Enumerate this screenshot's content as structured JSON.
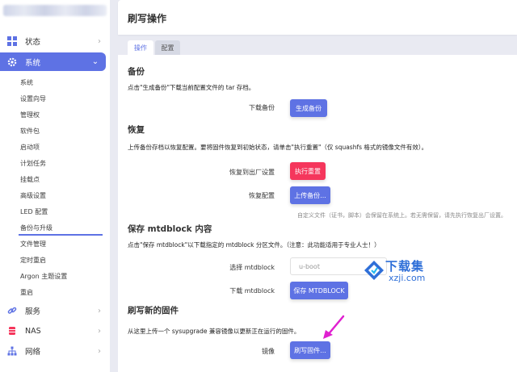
{
  "sidebar": {
    "top_item": {
      "label": "状态",
      "icon": "dashboard-icon"
    },
    "main_item": {
      "label": "系统",
      "icon": "gear-icon"
    },
    "sub_items": [
      "系统",
      "设置向导",
      "管理权",
      "软件包",
      "启动项",
      "计划任务",
      "挂载点",
      "高级设置",
      "LED 配置",
      "备份与升级",
      "文件管理",
      "定时重启",
      "Argon 主题设置",
      "重启"
    ],
    "bottom_items": [
      {
        "label": "服务",
        "icon": "link-icon"
      },
      {
        "label": "NAS",
        "icon": "database-icon"
      },
      {
        "label": "网络",
        "icon": "network-icon"
      }
    ]
  },
  "header": {
    "title": "刷写操作"
  },
  "tabs": [
    {
      "label": "操作",
      "active": true
    },
    {
      "label": "配置",
      "active": false
    }
  ],
  "sections": {
    "backup": {
      "title": "备份",
      "desc": "点击\"生成备份\"下载当前配置文件的 tar 存档。",
      "download_label": "下载备份",
      "generate_button": "生成备份"
    },
    "restore": {
      "title": "恢复",
      "desc": "上传备份存档以恢复配置。要将固件恢复到初始状态，请单击\"执行重置\"（仅 squashfs 格式的镜像文件有效）。",
      "factory_label": "恢复到出厂设置",
      "reset_button": "执行重置",
      "restore_label": "恢复配置",
      "upload_button": "上传备份...",
      "hint": "自定义文件（证书，脚本）会保留在系统上。若无需保留，请先执行恢复出厂设置。"
    },
    "mtdblock": {
      "title": "保存 mtdblock 内容",
      "desc": "点击\"保存 mtdblock\"以下载指定的 mtdblock 分区文件。（注意：此功能适用于专业人士！）",
      "select_label": "选择 mtdblock",
      "select_value": "u-boot",
      "download_label": "下载 mtdblock",
      "save_button": "保存 MTDBLOCK"
    },
    "flash": {
      "title": "刷写新的固件",
      "desc": "从这里上传一个 sysupgrade 兼容镜像以更新正在运行的固件。",
      "image_label": "镜像",
      "flash_button": "刷写固件..."
    }
  },
  "watermark": {
    "title": "下载集",
    "url": "xzji.com"
  },
  "colors": {
    "accent": "#5e72e4",
    "danger": "#f5365c",
    "watermark": "#2f6fd8",
    "arrow": "#e020d0"
  }
}
